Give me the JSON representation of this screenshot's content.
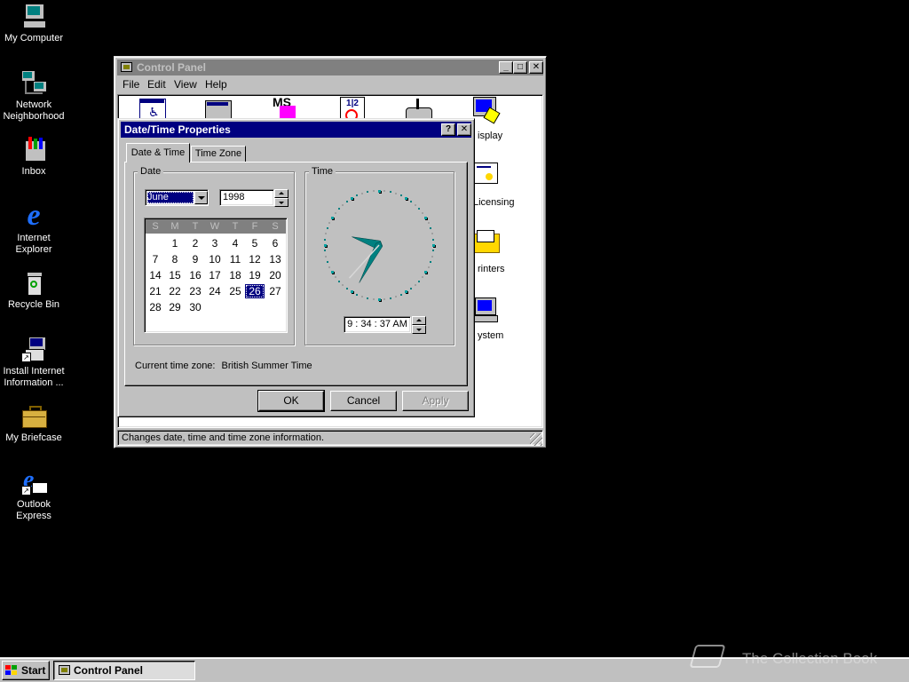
{
  "desktop": {
    "icons": [
      {
        "label": "My Computer",
        "icon": "computer-icon"
      },
      {
        "label": "Network Neighborhood",
        "icon": "network-icon"
      },
      {
        "label": "Inbox",
        "icon": "inbox-icon"
      },
      {
        "label": "Internet Explorer",
        "icon": "ie-icon"
      },
      {
        "label": "Recycle Bin",
        "icon": "recycle-bin-icon"
      },
      {
        "label": "Install Internet Information ...",
        "icon": "setup-icon"
      },
      {
        "label": "My Briefcase",
        "icon": "briefcase-icon"
      },
      {
        "label": "Outlook Express",
        "icon": "outlook-express-icon"
      }
    ]
  },
  "control_panel": {
    "title": "Control Panel",
    "menu": [
      "File",
      "Edit",
      "View",
      "Help"
    ],
    "icons_partial": [
      "isplay",
      "Licensing",
      "rinters",
      "ystem"
    ],
    "status": "Changes date, time and time zone information."
  },
  "dialog": {
    "title": "Date/Time Properties",
    "help_glyph": "?",
    "close_glyph": "✕",
    "tabs": [
      "Date & Time",
      "Time Zone"
    ],
    "date_group": "Date",
    "time_group": "Time",
    "month": "June",
    "year": "1998",
    "weekdays": [
      "S",
      "M",
      "T",
      "W",
      "T",
      "F",
      "S"
    ],
    "first_weekday_index": 1,
    "days_in_month": 30,
    "selected_day": 26,
    "time_value": "9 : 34 : 37 AM",
    "clock": {
      "hour": 9,
      "minute": 34,
      "second": 37
    },
    "timezone_label": "Current time zone:",
    "timezone_value": "British Summer Time",
    "ok": "OK",
    "cancel": "Cancel",
    "apply": "Apply"
  },
  "taskbar": {
    "start": "Start",
    "task": "Control Panel"
  },
  "watermark": "The Collection Book",
  "colors": {
    "desktop": "#000000",
    "titlebar_active": "#000080",
    "titlebar_inactive": "#808080",
    "face": "#c0c0c0",
    "clock_hands": "#008080"
  }
}
